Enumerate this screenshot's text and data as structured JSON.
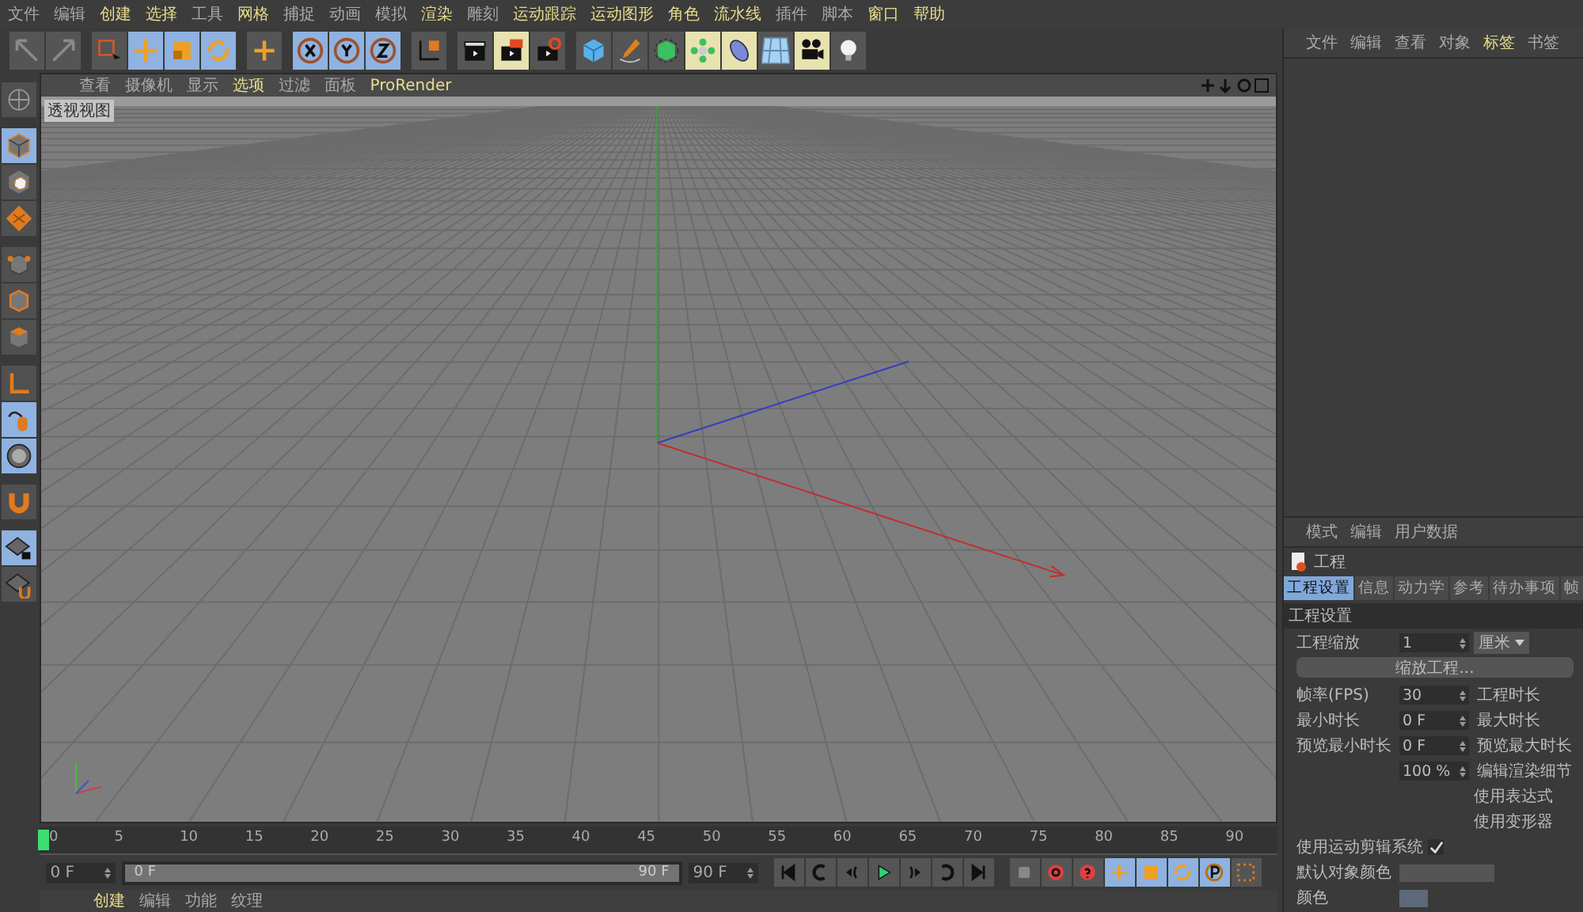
{
  "menu_bar": [
    {
      "label": "文件",
      "highlighted": false
    },
    {
      "label": "编辑",
      "highlighted": false
    },
    {
      "label": "创建",
      "highlighted": true
    },
    {
      "label": "选择",
      "highlighted": true
    },
    {
      "label": "工具",
      "highlighted": false
    },
    {
      "label": "网格",
      "highlighted": true
    },
    {
      "label": "捕捉",
      "highlighted": false
    },
    {
      "label": "动画",
      "highlighted": false
    },
    {
      "label": "模拟",
      "highlighted": false
    },
    {
      "label": "渲染",
      "highlighted": true
    },
    {
      "label": "雕刻",
      "highlighted": false
    },
    {
      "label": "运动跟踪",
      "highlighted": true
    },
    {
      "label": "运动图形",
      "highlighted": true
    },
    {
      "label": "角色",
      "highlighted": true
    },
    {
      "label": "流水线",
      "highlighted": true
    },
    {
      "label": "插件",
      "highlighted": false
    },
    {
      "label": "脚本",
      "highlighted": false
    },
    {
      "label": "窗口",
      "highlighted": true
    },
    {
      "label": "帮助",
      "highlighted": true
    }
  ],
  "toolbar": [
    {
      "kind": "undo",
      "active": false
    },
    {
      "kind": "redo",
      "active": false
    },
    {
      "kind": "select",
      "active": false
    },
    {
      "kind": "move",
      "active": true
    },
    {
      "kind": "scale",
      "active": true
    },
    {
      "kind": "rotate",
      "active": true
    },
    {
      "kind": "add",
      "active": false
    },
    {
      "kind": "x",
      "active": true
    },
    {
      "kind": "y",
      "active": true
    },
    {
      "kind": "z",
      "active": true
    },
    {
      "kind": "coord",
      "active": false
    },
    {
      "kind": "render",
      "active": false
    },
    {
      "kind": "renderview",
      "active": true
    },
    {
      "kind": "rendersettings",
      "active": false
    },
    {
      "kind": "cube",
      "active": false
    },
    {
      "kind": "pen",
      "active": false
    },
    {
      "kind": "subdiv",
      "active": false
    },
    {
      "kind": "cloner",
      "active": true
    },
    {
      "kind": "deformer",
      "active": true
    },
    {
      "kind": "floor",
      "active": false
    },
    {
      "kind": "camera",
      "active": true
    },
    {
      "kind": "light",
      "active": false
    }
  ],
  "left_toolbar": [
    {
      "kind": "editable",
      "active": false
    },
    {
      "kind": "model",
      "active": true
    },
    {
      "kind": "texture",
      "active": false
    },
    {
      "kind": "workplane",
      "active": false
    },
    {
      "kind": "points",
      "active": false
    },
    {
      "kind": "edges",
      "active": false
    },
    {
      "kind": "polygons",
      "active": false
    },
    {
      "kind": "axis",
      "active": false
    },
    {
      "kind": "tweak",
      "active": true
    },
    {
      "kind": "snap",
      "active": true
    },
    {
      "kind": "magnet",
      "active": false
    },
    {
      "kind": "lockplane",
      "active": true
    },
    {
      "kind": "planar",
      "active": false
    }
  ],
  "viewport": {
    "menu": [
      {
        "label": "查看",
        "highlighted": false
      },
      {
        "label": "摄像机",
        "highlighted": false
      },
      {
        "label": "显示",
        "highlighted": false
      },
      {
        "label": "选项",
        "highlighted": true
      },
      {
        "label": "过滤",
        "highlighted": false
      },
      {
        "label": "面板",
        "highlighted": false
      },
      {
        "label": "ProRender",
        "highlighted": true
      }
    ],
    "label": "透视视图"
  },
  "object_manager": {
    "menu": [
      {
        "label": "文件",
        "highlighted": false
      },
      {
        "label": "编辑",
        "highlighted": false
      },
      {
        "label": "查看",
        "highlighted": false
      },
      {
        "label": "对象",
        "highlighted": false
      },
      {
        "label": "标签",
        "highlighted": true
      },
      {
        "label": "书签",
        "highlighted": false
      }
    ]
  },
  "attributes": {
    "menu": [
      "模式",
      "编辑",
      "用户数据"
    ],
    "title": "工程",
    "tabs": [
      {
        "label": "工程设置",
        "selected": true
      },
      {
        "label": "信息",
        "selected": false
      },
      {
        "label": "动力学",
        "selected": false
      },
      {
        "label": "参考",
        "selected": false
      },
      {
        "label": "待办事项",
        "selected": false
      },
      {
        "label": "帧",
        "selected": false
      }
    ],
    "section": "工程设置",
    "scale": {
      "label": "工程缩放",
      "value": "1",
      "unit": "厘米"
    },
    "scale_button": "缩放工程...",
    "rows": [
      {
        "label": "帧率(FPS)",
        "value": "30",
        "right": "工程时长"
      },
      {
        "label": "最小时长",
        "value": "0 F",
        "right": "最大时长"
      },
      {
        "label": "预览最小时长",
        "value": "0 F",
        "right": "预览最大时长"
      },
      {
        "label": "",
        "value": "100 %",
        "right": "编辑渲染细节"
      },
      {
        "label": "",
        "value": "",
        "right": "使用表达式"
      },
      {
        "label": "",
        "value": "",
        "right": "使用变形器"
      }
    ],
    "checkbox": {
      "label": "使用运动剪辑系统",
      "checked": true
    },
    "object_color": {
      "label": "默认对象颜色"
    },
    "color": {
      "label": "颜色",
      "color": "#5d6978"
    }
  },
  "timeline": {
    "ticks": [
      "0",
      "5",
      "10",
      "15",
      "20",
      "25",
      "30",
      "35",
      "40",
      "45",
      "50",
      "55",
      "60",
      "65",
      "70",
      "75",
      "80",
      "85",
      "90"
    ],
    "level": 0
  },
  "frame_controls": {
    "level": 1,
    "start": "0 F",
    "slider_start": "0 F",
    "slider_end": "90 F",
    "end": "90 F"
  },
  "material_manager": {
    "menu": [
      {
        "label": "创建",
        "highlighted": true
      },
      {
        "label": "编辑",
        "highlighted": false
      },
      {
        "label": "功能",
        "highlighted": false
      },
      {
        "label": "纹理",
        "highlighted": false
      }
    ]
  }
}
